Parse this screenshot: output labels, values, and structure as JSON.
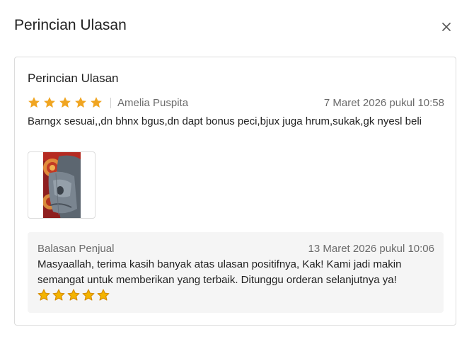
{
  "modal": {
    "title": "Perincian Ulasan",
    "close_icon": "close-icon"
  },
  "review": {
    "card_title": "Perincian Ulasan",
    "rating": 5,
    "reviewer": "Amelia Puspita",
    "date": "7 Maret 2026 pukul 10:58",
    "text": "Barngx sesuai,,dn bhnx bgus,dn dapt bonus peci,bjux juga hrum,sukak,gk nyesl beli",
    "photo_icon": "review-photo"
  },
  "seller_reply": {
    "label": "Balasan Penjual",
    "date": "13 Maret 2026 pukul 10:06",
    "text": "Masyaallah, terima kasih banyak atas ulasan positifnya, Kak! Kami jadi makin semangat untuk memberikan yang terbaik. Ditunggu orderan selanjutnya ya!",
    "emoji_stars": 5
  },
  "colors": {
    "star": "#f0a521",
    "reply_star": "#f4b400",
    "muted_text": "#6b6b6b",
    "border": "#dcdcdc",
    "reply_bg": "#f5f5f5"
  }
}
